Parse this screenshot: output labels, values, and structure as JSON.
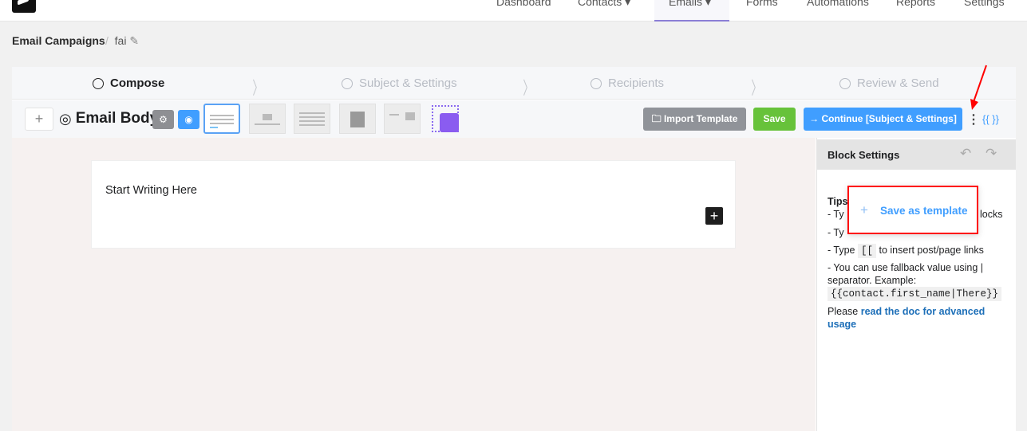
{
  "nav": {
    "items": [
      "Dashboard",
      "Contacts ▾",
      "Emails ▾",
      "Forms",
      "Automations",
      "Reports",
      "Settings"
    ],
    "active": "Emails"
  },
  "breadcrumb": {
    "parent": "Email Campaigns",
    "separator": "/",
    "current": "fai"
  },
  "steps": [
    "Compose",
    "Subject & Settings",
    "Recipients",
    "Review & Send"
  ],
  "toolbar": {
    "add": "+",
    "title": "Email Body",
    "import": "Import Template",
    "save": "Save",
    "continue": "→ Continue [Subject & Settings]",
    "more": "⋮",
    "merge_tags": "{{ }}"
  },
  "editor": {
    "placeholder": "Start Writing Here",
    "add_block": "+"
  },
  "sidebar": {
    "title": "Block Settings",
    "tips_label": "Tips",
    "tip1_start": "- Ty",
    "tip1_end": "locks",
    "tip2_start": "- Ty",
    "tip3_a": "- Type",
    "tip3_code": "[[",
    "tip3_b": "to insert post/page links",
    "tip4": "- You can use fallback value using | separator. Example:",
    "tip4_code": "{{contact.first_name|There}}",
    "doc_prefix": "Please",
    "doc_link": "read the doc for advanced usage"
  },
  "popup": {
    "plus": "+",
    "label": "Save as template"
  },
  "colors": {
    "accent": "#409eff",
    "save": "#67c23a",
    "import": "#909399",
    "highlight": "#ff0000"
  }
}
